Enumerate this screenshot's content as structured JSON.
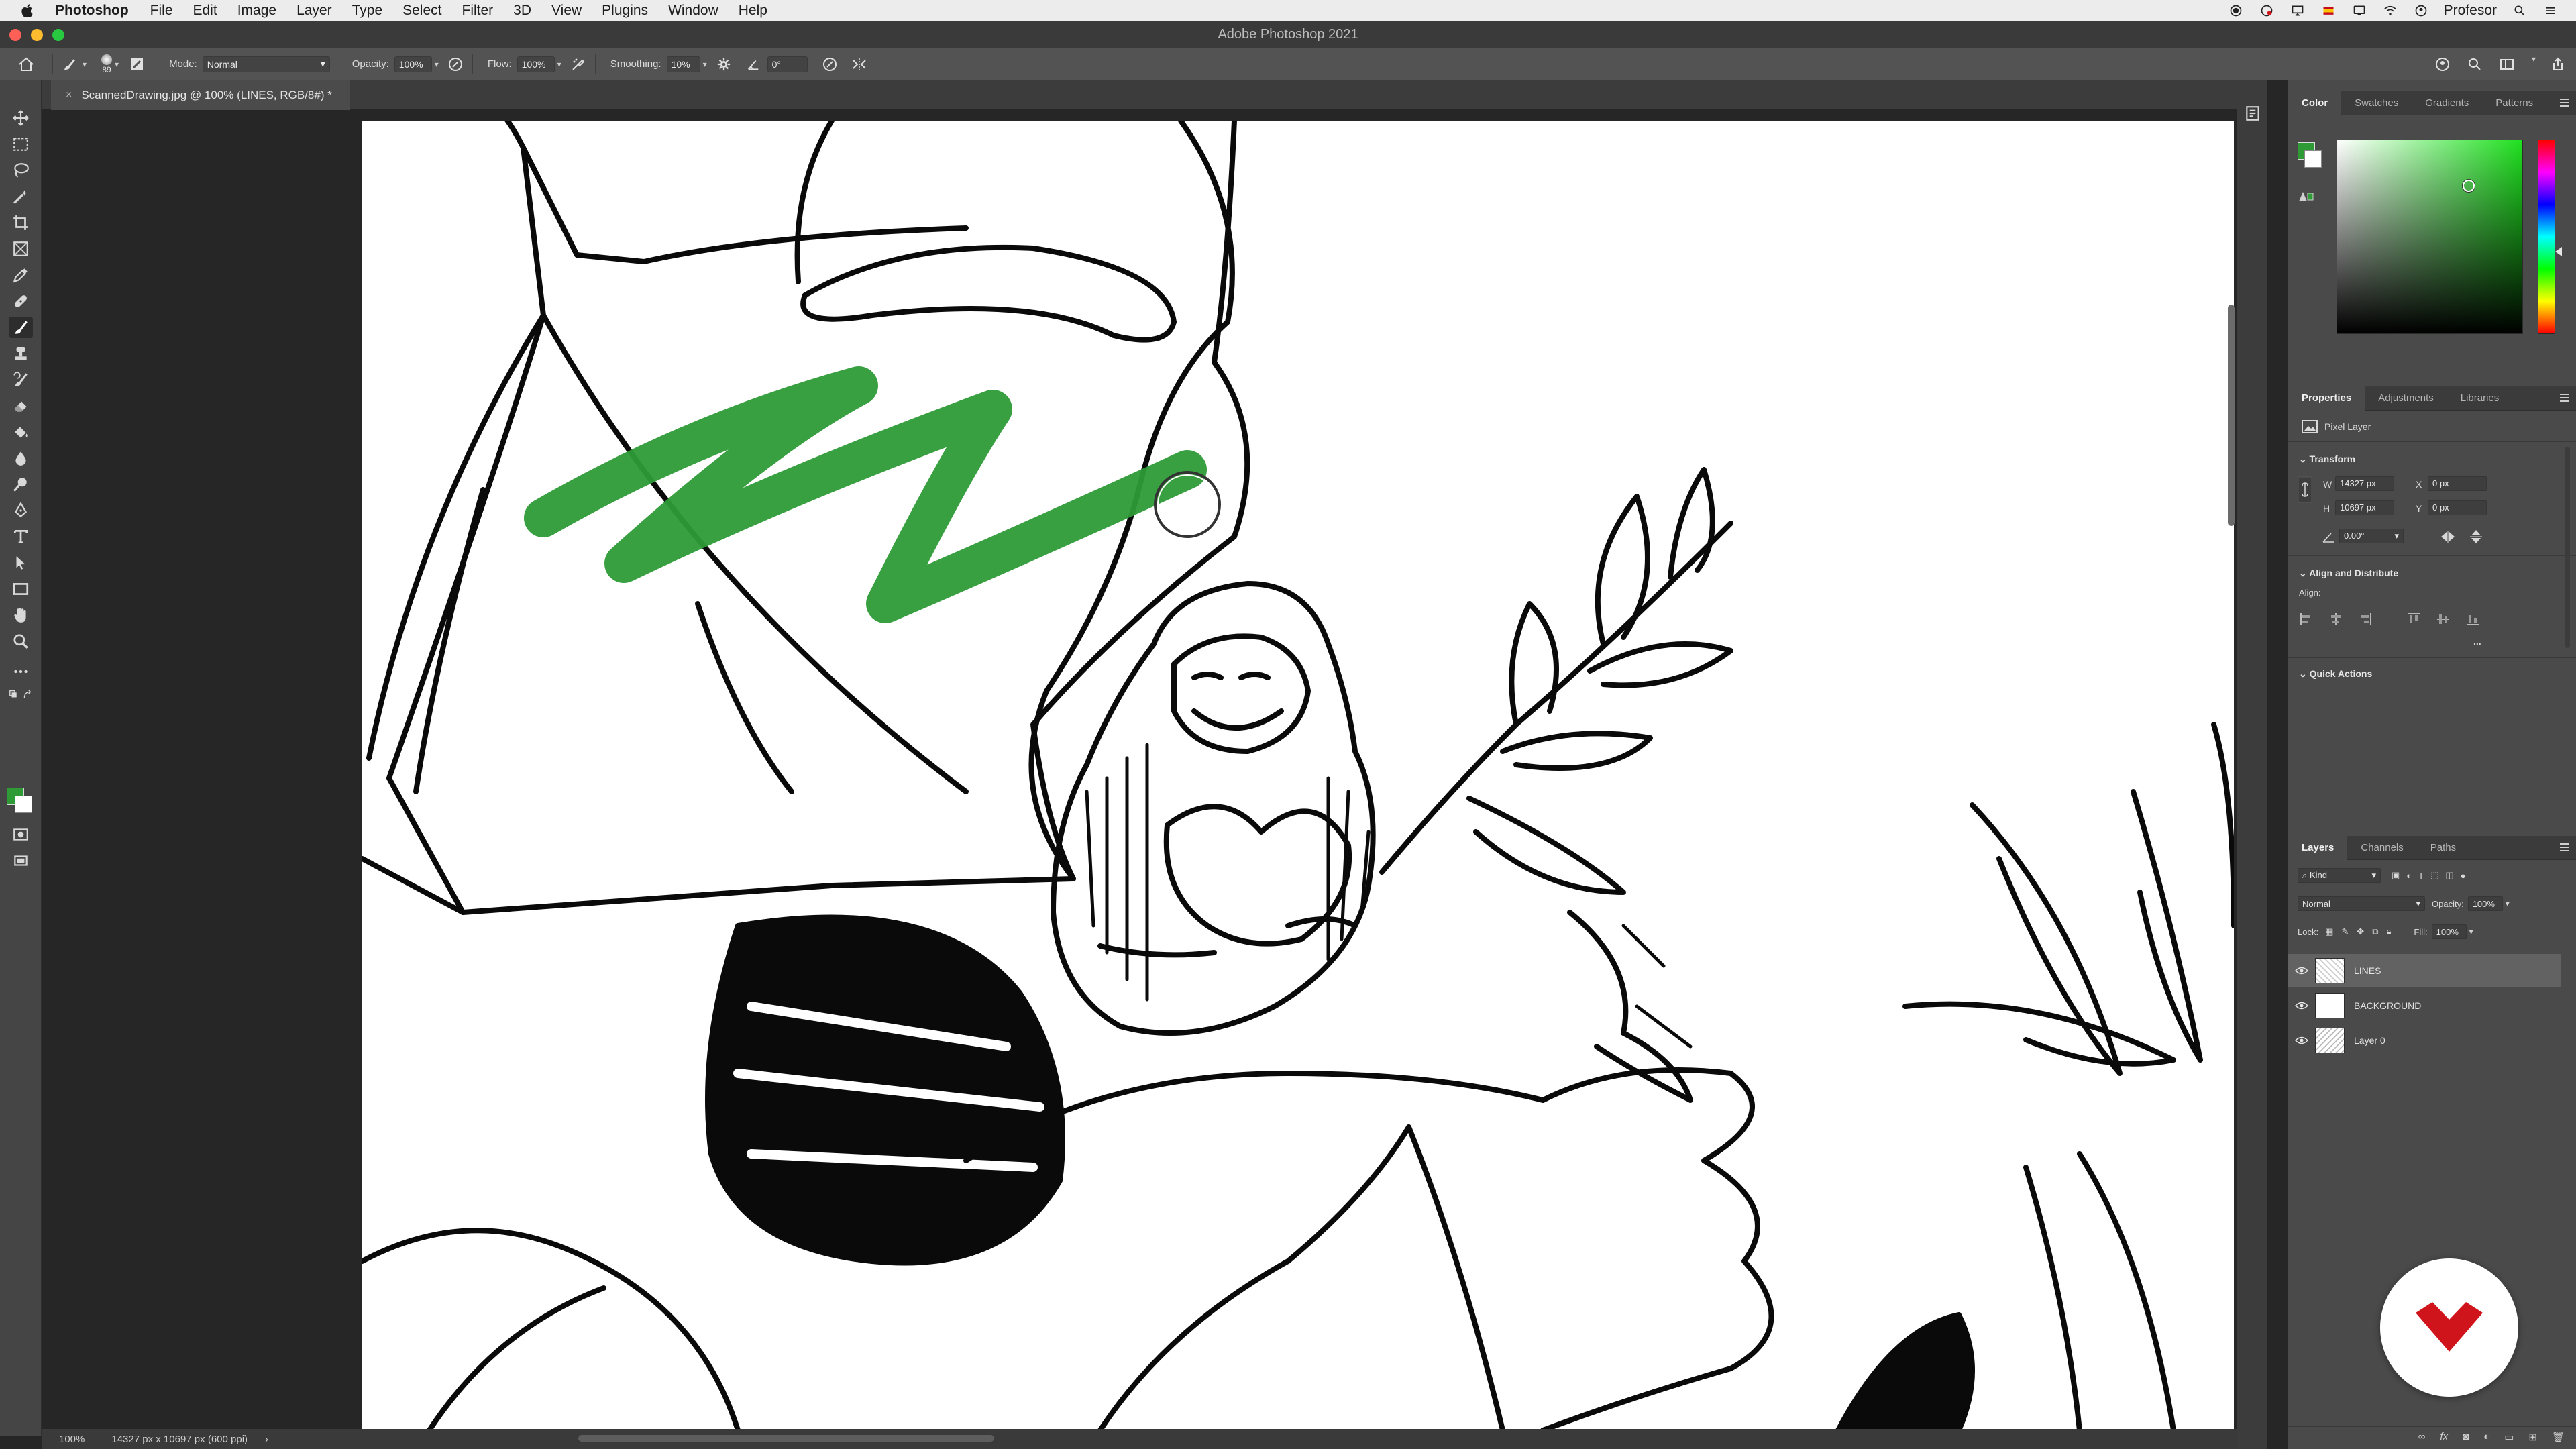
{
  "menubar": {
    "app_name": "Photoshop",
    "items": [
      "File",
      "Edit",
      "Image",
      "Layer",
      "Type",
      "Select",
      "Filter",
      "3D",
      "View",
      "Plugins",
      "Window",
      "Help"
    ],
    "user": "Profesor"
  },
  "window": {
    "title": "Adobe Photoshop 2021"
  },
  "options_bar": {
    "brush_size": "89",
    "mode_label": "Mode:",
    "mode_value": "Normal",
    "opacity_label": "Opacity:",
    "opacity_value": "100%",
    "flow_label": "Flow:",
    "flow_value": "100%",
    "smoothing_label": "Smoothing:",
    "smoothing_value": "10%",
    "angle_value": "0°"
  },
  "document": {
    "tab_title": "ScannedDrawing.jpg @ 100% (LINES, RGB/8#) *",
    "close_glyph": "×"
  },
  "status_bar": {
    "zoom": "100%",
    "dimensions": "14327 px x 10697 px (600 ppi)",
    "arrow": "›"
  },
  "color_panel": {
    "tabs": [
      "Color",
      "Swatches",
      "Gradients",
      "Patterns"
    ],
    "foreground_color": "#2e9b37",
    "background_color": "#ffffff"
  },
  "properties_panel": {
    "tabs": [
      "Properties",
      "Adjustments",
      "Libraries"
    ],
    "layer_type": "Pixel Layer",
    "transform_title": "Transform",
    "w_label": "W",
    "w_value": "14327 px",
    "h_label": "H",
    "h_value": "10697 px",
    "x_label": "X",
    "x_value": "0 px",
    "y_label": "Y",
    "y_value": "0 px",
    "angle_value": "0.00°",
    "align_title": "Align and Distribute",
    "align_label": "Align:",
    "more": "...",
    "quick_actions_title": "Quick Actions"
  },
  "layers_panel": {
    "tabs": [
      "Layers",
      "Channels",
      "Paths"
    ],
    "kind_filter": "Kind",
    "blend_mode": "Normal",
    "opacity_label": "Opacity:",
    "opacity_value": "100%",
    "lock_label": "Lock:",
    "fill_label": "Fill:",
    "fill_value": "100%",
    "layers": [
      {
        "name": "LINES",
        "selected": true
      },
      {
        "name": "BACKGROUND",
        "selected": false
      },
      {
        "name": "Layer 0",
        "selected": false
      }
    ],
    "footer_fx": "fx"
  },
  "tools": [
    "move-tool",
    "marquee-tool",
    "lasso-tool",
    "magic-wand-tool",
    "crop-tool",
    "frame-tool",
    "eyedropper-tool",
    "healing-brush-tool",
    "brush-tool",
    "clone-stamp-tool",
    "history-brush-tool",
    "eraser-tool",
    "paint-bucket-tool",
    "blur-tool",
    "dodge-tool",
    "pen-tool",
    "type-tool",
    "path-selection-tool",
    "rectangle-tool",
    "hand-tool",
    "zoom-tool",
    "more-tools"
  ],
  "colors": {
    "brush_stroke": "#2e9b37",
    "brand_red": "#d0141b"
  }
}
